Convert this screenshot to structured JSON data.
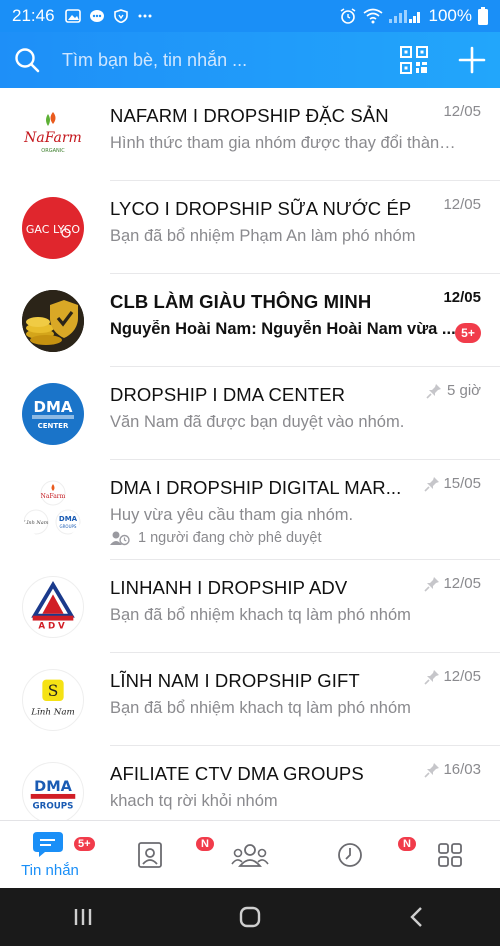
{
  "status_bar": {
    "time": "21:46",
    "battery": "100%"
  },
  "header": {
    "search_placeholder": "Tìm bạn bè, tin nhắn ..."
  },
  "conversations": [
    {
      "title": "NAFARM I DROPSHIP ĐẶC SẢN",
      "subtitle": "Hình thức tham gia nhóm được thay đổi thành ...",
      "time": "12/05",
      "avatar_text": "NaFarm"
    },
    {
      "title": "LYCO I DROPSHIP SỮA NƯỚC ÉP",
      "subtitle": "Bạn đã bổ nhiệm Phạm An làm phó nhóm",
      "time": "12/05",
      "avatar_text": "GAC LYCO"
    },
    {
      "title": "CLB LÀM GIÀU THÔNG MINH",
      "subtitle": "Nguyễn Hoài Nam: Nguyễn Hoài Nam vừa ...",
      "time": "12/05",
      "badge": "5+"
    },
    {
      "title": "DROPSHIP I DMA CENTER",
      "subtitle": "Văn Nam đã được bạn duyệt vào nhóm.",
      "time": "5 giờ",
      "avatar_text": "DMA",
      "avatar_sub": "CENTER"
    },
    {
      "title": "DMA I DROPSHIP DIGITAL MAR...",
      "subtitle": "Huy vừa yêu cầu tham gia nhóm.",
      "time": "15/05",
      "extra": "1 người đang chờ phê duyệt"
    },
    {
      "title": "LINHANH I DROPSHIP ADV",
      "subtitle": "Bạn đã bổ nhiệm khach tq làm phó nhóm",
      "time": "12/05",
      "avatar_text": "ADV"
    },
    {
      "title": "LĨNH NAM I DROPSHIP GIFT",
      "subtitle": "Bạn đã bổ nhiệm khach tq làm phó nhóm",
      "time": "12/05",
      "avatar_text": "Lĩnh Nam"
    },
    {
      "title": "AFILIATE CTV DMA GROUPS",
      "subtitle": "khach tq rời khỏi nhóm",
      "time": "16/03",
      "avatar_text": "DMA",
      "avatar_sub": "GROUPS"
    }
  ],
  "tabs": {
    "messages_label": "Tin nhắn",
    "messages_badge": "5+",
    "contacts_badge": "N",
    "timeline_badge": "N"
  },
  "colors": {
    "accent": "#1a8ff7",
    "badge": "#f13c4b"
  }
}
